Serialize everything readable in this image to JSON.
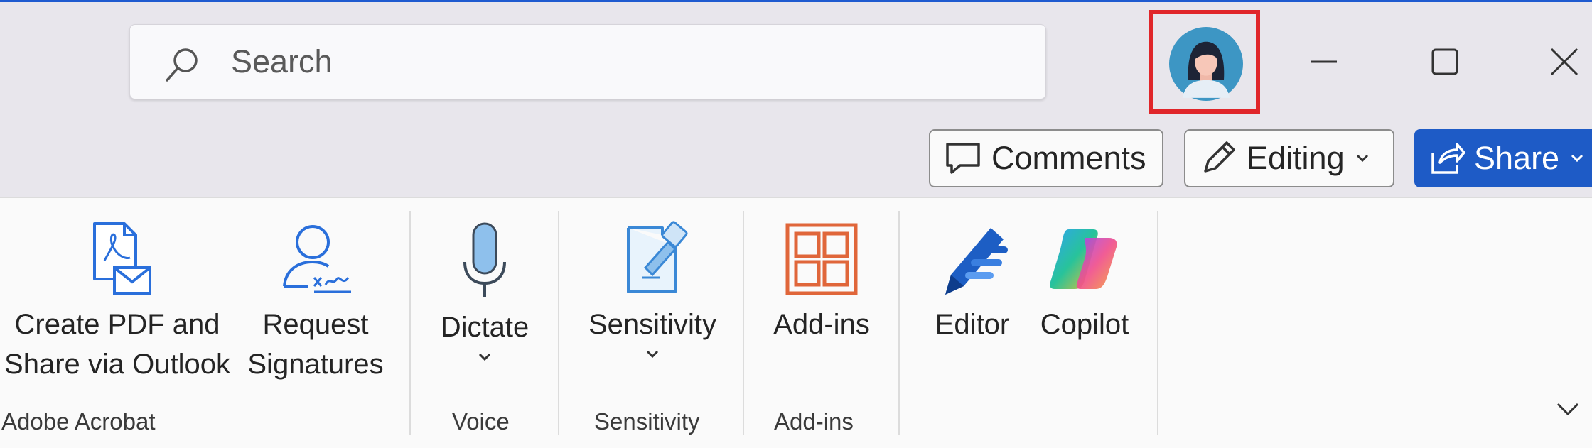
{
  "search": {
    "placeholder": "Search"
  },
  "titlebar": {
    "avatar": "user-avatar",
    "minimize": "minimize-icon",
    "maximize": "maximize-icon",
    "close": "close-icon"
  },
  "actions": {
    "comments_label": "Comments",
    "editing_label": "Editing",
    "share_label": "Share",
    "share_color": "#1e5bc6"
  },
  "ribbon": {
    "buttons": [
      {
        "label_line1": "Create PDF and",
        "label_line2": "Share via Outlook",
        "icon": "pdf-mail-icon"
      },
      {
        "label_line1": "Request",
        "label_line2": "Signatures",
        "icon": "signature-icon"
      },
      {
        "label": "Dictate",
        "icon": "microphone-icon"
      },
      {
        "label": "Sensitivity",
        "icon": "sensitivity-icon"
      },
      {
        "label": "Add-ins",
        "icon": "addins-icon"
      },
      {
        "label": "Editor",
        "icon": "editor-pen-icon"
      },
      {
        "label": "Copilot",
        "icon": "copilot-icon"
      }
    ],
    "groups": [
      "Adobe Acrobat",
      "Voice",
      "Sensitivity",
      "Add-ins"
    ]
  },
  "highlight_color": "#e0262a"
}
